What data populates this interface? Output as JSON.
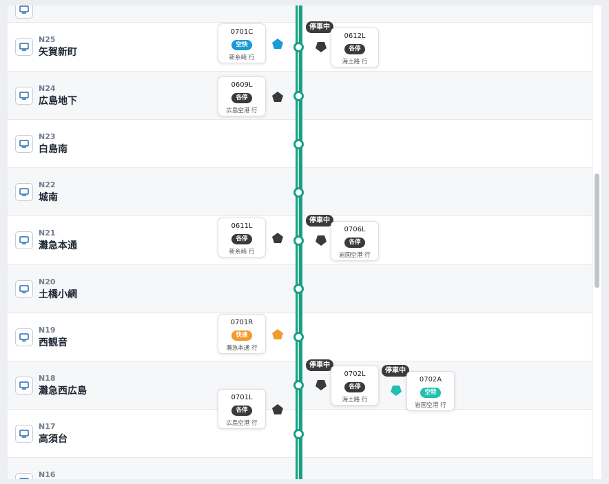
{
  "colors": {
    "line": "#17a085",
    "local": "#3a3a3a",
    "semi_express": "#1a9ad6",
    "rapid": "#f29a2e",
    "limited_express": "#1fbfb1"
  },
  "icons": {
    "station": "monitor-icon",
    "train": "pentagon-train-icon"
  },
  "status": {
    "stopped": "停車中"
  },
  "stations": [
    {
      "code": "N25",
      "name": "矢賀新町"
    },
    {
      "code": "N24",
      "name": "広島地下"
    },
    {
      "code": "N23",
      "name": "白島南"
    },
    {
      "code": "N22",
      "name": "城南"
    },
    {
      "code": "N21",
      "name": "灘急本通"
    },
    {
      "code": "N20",
      "name": "土橋小網"
    },
    {
      "code": "N19",
      "name": "西観音"
    },
    {
      "code": "N18",
      "name": "灘急西広島"
    },
    {
      "code": "N17",
      "name": "高須台"
    },
    {
      "code": "N16",
      "name": ""
    }
  ],
  "trains": [
    {
      "id": "0701C",
      "type": "空快",
      "dest": "新糸崎 行",
      "color": "semi_express"
    },
    {
      "id": "0612L",
      "type": "各停",
      "dest": "海土路 行",
      "color": "local"
    },
    {
      "id": "0609L",
      "type": "各停",
      "dest": "広島空港 行",
      "color": "local"
    },
    {
      "id": "0611L",
      "type": "各停",
      "dest": "新糸崎 行",
      "color": "local"
    },
    {
      "id": "0706L",
      "type": "各停",
      "dest": "岩国空港 行",
      "color": "local"
    },
    {
      "id": "0701R",
      "type": "快速",
      "dest": "灘急本通 行",
      "color": "rapid"
    },
    {
      "id": "0702L",
      "type": "各停",
      "dest": "海土路 行",
      "color": "local"
    },
    {
      "id": "0702A",
      "type": "空特",
      "dest": "岩国空港 行",
      "color": "limited_express"
    },
    {
      "id": "0701L",
      "type": "各停",
      "dest": "広島空港 行",
      "color": "local"
    }
  ]
}
